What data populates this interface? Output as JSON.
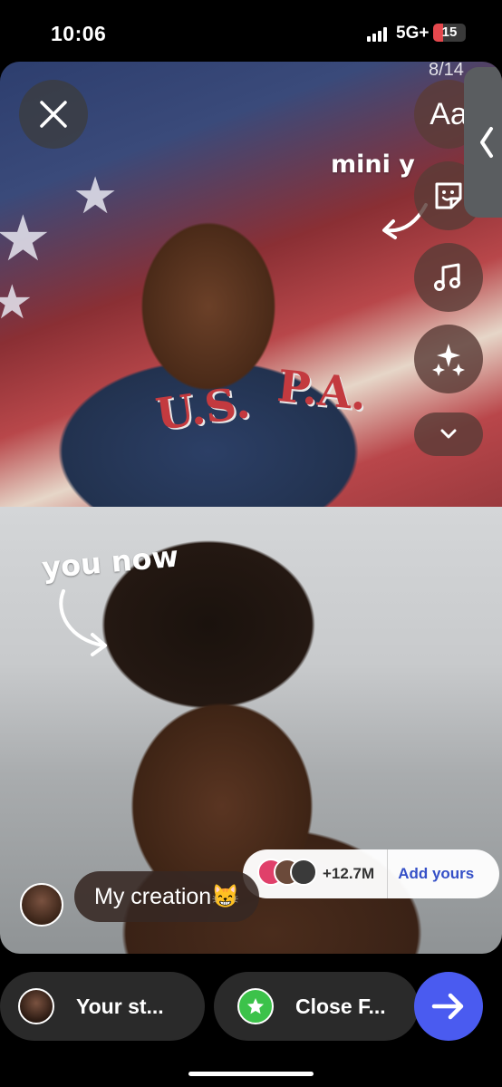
{
  "status_bar": {
    "time": "10:06",
    "network": "5G+",
    "battery": "15",
    "battery_color": "#e5484d"
  },
  "story": {
    "page_indicator": "8/14",
    "text_tool_label": "Aa",
    "sticker_top_text": "mini y",
    "sticker_bottom_text": "you now",
    "photo_top_jacket_text_left": "U.S.",
    "photo_top_jacket_text_right": "P.A.",
    "caption": "My creation😸",
    "add_yours": {
      "count": "+12.7M",
      "label": "Add yours",
      "label_color": "#3550c7"
    },
    "tools": [
      {
        "icon": "text-icon"
      },
      {
        "icon": "sticker-icon"
      },
      {
        "icon": "music-icon"
      },
      {
        "icon": "sparkles-icon"
      },
      {
        "icon": "chevron-down-icon"
      }
    ]
  },
  "share_bar": {
    "your_story_label": "Your st...",
    "close_friends_label": "Close F...",
    "close_friends_color": "#3cc24a",
    "send_color": "#4a5bf0"
  }
}
